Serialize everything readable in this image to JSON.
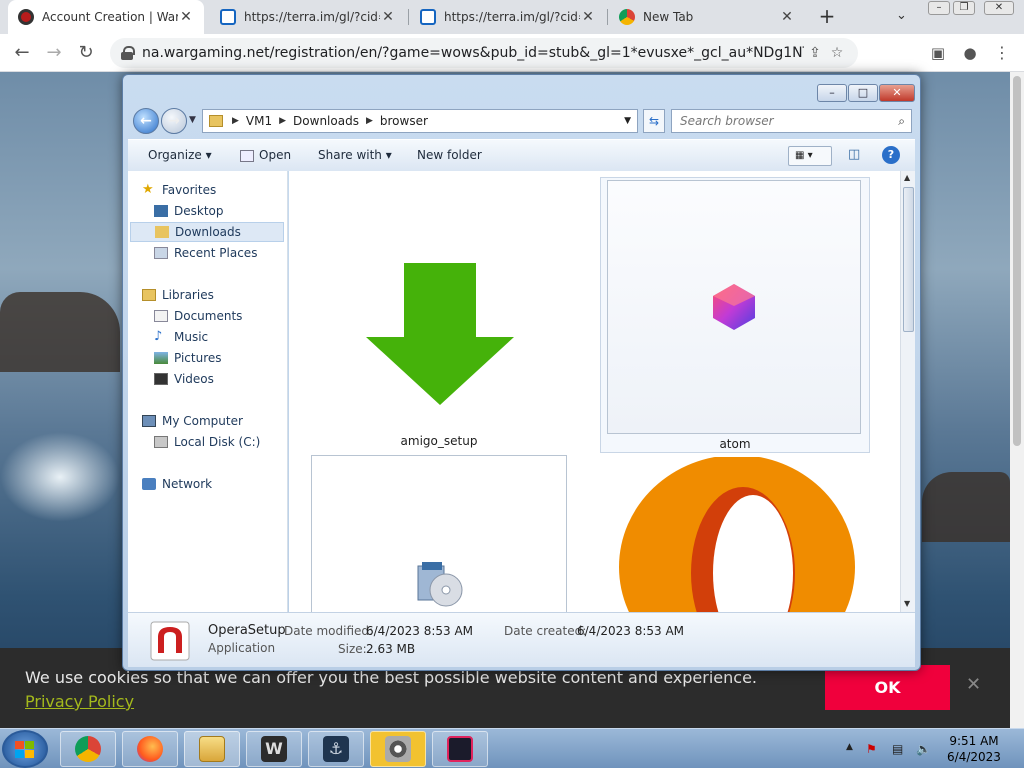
{
  "browser": {
    "tabs": [
      {
        "title": "Account Creation | Warg",
        "favicon": "wargaming-icon",
        "active": true
      },
      {
        "title": "https://terra.im/gl/?cid=",
        "favicon": "edge-icon",
        "active": false
      },
      {
        "title": "https://terra.im/gl/?cid=",
        "favicon": "edge-icon",
        "active": false
      },
      {
        "title": "New Tab",
        "favicon": "chrome-icon",
        "active": false
      }
    ],
    "new_tab_glyph": "+",
    "url": "na.wargaming.net/registration/en/?game=wows&pub_id=stub&_gl=1*evusxe*_gcl_au*NDg1NTExMDUzLjE2OD..."
  },
  "cookie_bar": {
    "message": "We use cookies so that we can offer you the best possible website content and experience.",
    "link": "Privacy Policy",
    "ok_label": "OK",
    "close_glyph": "✕"
  },
  "explorer": {
    "path": [
      "VM1",
      "Downloads",
      "browser"
    ],
    "search_placeholder": "Search browser",
    "commands": {
      "organize": "Organize",
      "open": "Open",
      "share_with": "Share with",
      "new_folder": "New folder"
    },
    "nav": {
      "favorites": "Favorites",
      "favorites_items": [
        "Desktop",
        "Downloads",
        "Recent Places"
      ],
      "libraries": "Libraries",
      "libraries_items": [
        "Documents",
        "Music",
        "Pictures",
        "Videos"
      ],
      "my_computer": "My Computer",
      "local_disk": "Local Disk (C:)",
      "network": "Network"
    },
    "files": [
      {
        "name": "amigo_setup",
        "icon": "green-download-arrow-icon"
      },
      {
        "name": "atom",
        "icon": "atom-gem-icon"
      },
      {
        "name": "",
        "icon": "installer-cd-icon"
      },
      {
        "name": "",
        "icon": "opera-logo-icon"
      }
    ],
    "details": {
      "name": "OperaSetup",
      "type": "Application",
      "modified_label": "Date modified:",
      "modified": "6/4/2023 8:53 AM",
      "created_label": "Date created:",
      "created": "6/4/2023 8:53 AM",
      "size_label": "Size:",
      "size": "2.63 MB"
    }
  },
  "taskbar": {
    "apps": [
      "chrome-icon",
      "firefox-icon",
      "explorer-folder-icon",
      "world-of-tanks-icon",
      "world-of-warships-icon",
      "raccoon-app-icon",
      "opera-gx-icon"
    ],
    "time": "9:51 AM",
    "date": "6/4/2023"
  },
  "colors": {
    "ok_button": "#f0003c",
    "privacy_link": "#a4b91c",
    "accent": "#1565c0"
  }
}
